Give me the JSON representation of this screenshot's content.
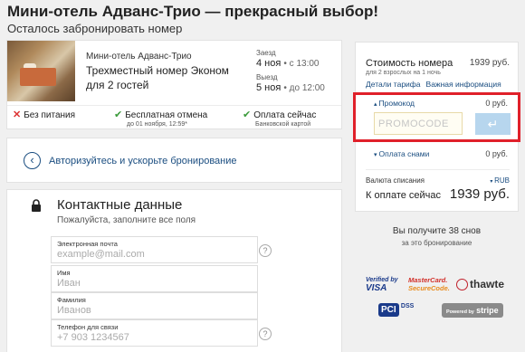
{
  "header": {
    "title": "Мини-отель Адванс-Трио — прекрасный выбор!",
    "subtitle": "Осталось забронировать номер"
  },
  "booking": {
    "hotel_name": "Мини-отель Адванс-Трио",
    "room_name": "Трехместный номер Эконом для 2 гостей",
    "checkin": {
      "label": "Заезд",
      "date": "4 ноя",
      "time": "с 13:00"
    },
    "checkout": {
      "label": "Выезд",
      "date": "5 ноя",
      "time": "до 12:00"
    },
    "features": [
      {
        "icon": "x-icon",
        "text": "Без питания",
        "sub": ""
      },
      {
        "icon": "check-icon",
        "text": "Бесплатная отмена",
        "sub": "до 01 ноября, 12:59*"
      },
      {
        "icon": "check-icon",
        "text": "Оплата сейчас",
        "sub": "Банковской картой"
      }
    ]
  },
  "login": {
    "text": "Авторизуйтесь и ускорьте бронирование"
  },
  "contact": {
    "title": "Контактные данные",
    "subtitle": "Пожалуйста, заполните все поля",
    "fields": [
      {
        "label": "Электронная почта",
        "placeholder": "example@mail.com",
        "value": ""
      },
      {
        "label": "Имя",
        "placeholder": "Иван",
        "value": ""
      },
      {
        "label": "Фамилия",
        "placeholder": "Иванов",
        "value": ""
      },
      {
        "label": "Телефон для связи",
        "placeholder": "+7 903 1234567",
        "value": ""
      }
    ]
  },
  "price": {
    "title": "Стоимость номера",
    "value": "1939 руб.",
    "subtitle": "для 2 взрослых на 1 ночь",
    "link_details": "Детали тарифа",
    "link_info": "Важная информация",
    "promo_label": "Промокод",
    "promo_value": "0 руб.",
    "promo_placeholder": "PROMOCODE",
    "promo_button": "↵",
    "pay_miles_label": "Оплата снами",
    "pay_miles_value": "0 руб.",
    "currency_label": "Валюта списания",
    "currency_value": "RUB",
    "total_label": "К оплате сейчас",
    "total_value": "1939 руб."
  },
  "bonus": {
    "main": "Вы получите 38 снов",
    "sub": "за это бронирование"
  },
  "logos": {
    "visa_line1": "Verified by",
    "visa_line2": "VISA",
    "mc_line1": "MasterCard.",
    "mc_line2": "SecureCode.",
    "thawte": "thawte",
    "pci": "PCI",
    "dss": "DSS",
    "stripe_pre": "Powered by",
    "stripe": "stripe"
  },
  "colors": {
    "accent": "#1a4d80",
    "highlight_frame": "#e0202a",
    "promo_button": "#b7d6ee"
  }
}
